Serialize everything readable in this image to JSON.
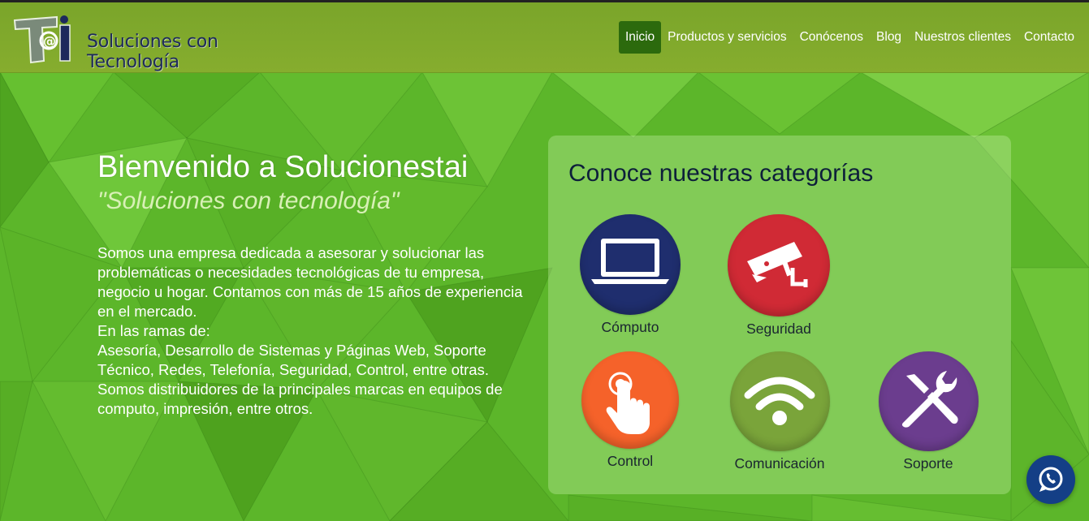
{
  "brand": {
    "logo_text": "Soluciones con Tecnología",
    "logo_mark": "Ti@"
  },
  "nav": {
    "items": [
      "Inicio",
      "Productos y servicios",
      "Conócenos",
      "Blog",
      "Nuestros clientes",
      "Contacto"
    ],
    "active": "Inicio"
  },
  "hero": {
    "title": "Bienvenido a Solucionestai",
    "slogan": "\"Soluciones con tecnología\"",
    "description": [
      "Somos una empresa dedicada a asesorar y solucionar las problemáticas o necesidades tecnológicas de tu empresa, negocio u hogar. Contamos con más de 15 años de experiencia en el mercado.",
      "En las ramas de:",
      "Asesoría, Desarrollo de Sistemas y Páginas Web, Soporte Técnico, Redes, Telefonía, Seguridad, Control, entre otras.",
      "Somos distribuidores de la principales marcas en equipos de computo, impresión, entre otros."
    ]
  },
  "categories": {
    "title": "Conoce nuestras categorías",
    "items": [
      {
        "label": "Cómputo",
        "icon": "laptop-icon",
        "color": "#1f2e6e"
      },
      {
        "label": "Seguridad",
        "icon": "security-camera-icon",
        "color": "#d02a35"
      },
      {
        "label": "Control",
        "icon": "touch-icon",
        "color": "#f5622a"
      },
      {
        "label": "Comunicación",
        "icon": "wifi-icon",
        "color": "#7aa43a"
      },
      {
        "label": "Soporte",
        "icon": "tools-icon",
        "color": "#6b3d8e"
      }
    ]
  },
  "floating": {
    "icon": "whatsapp-icon",
    "color": "#143f86"
  },
  "colors": {
    "header": "#7fa82b",
    "background": "#5fb82a",
    "nav_active": "#2c6a0d"
  }
}
